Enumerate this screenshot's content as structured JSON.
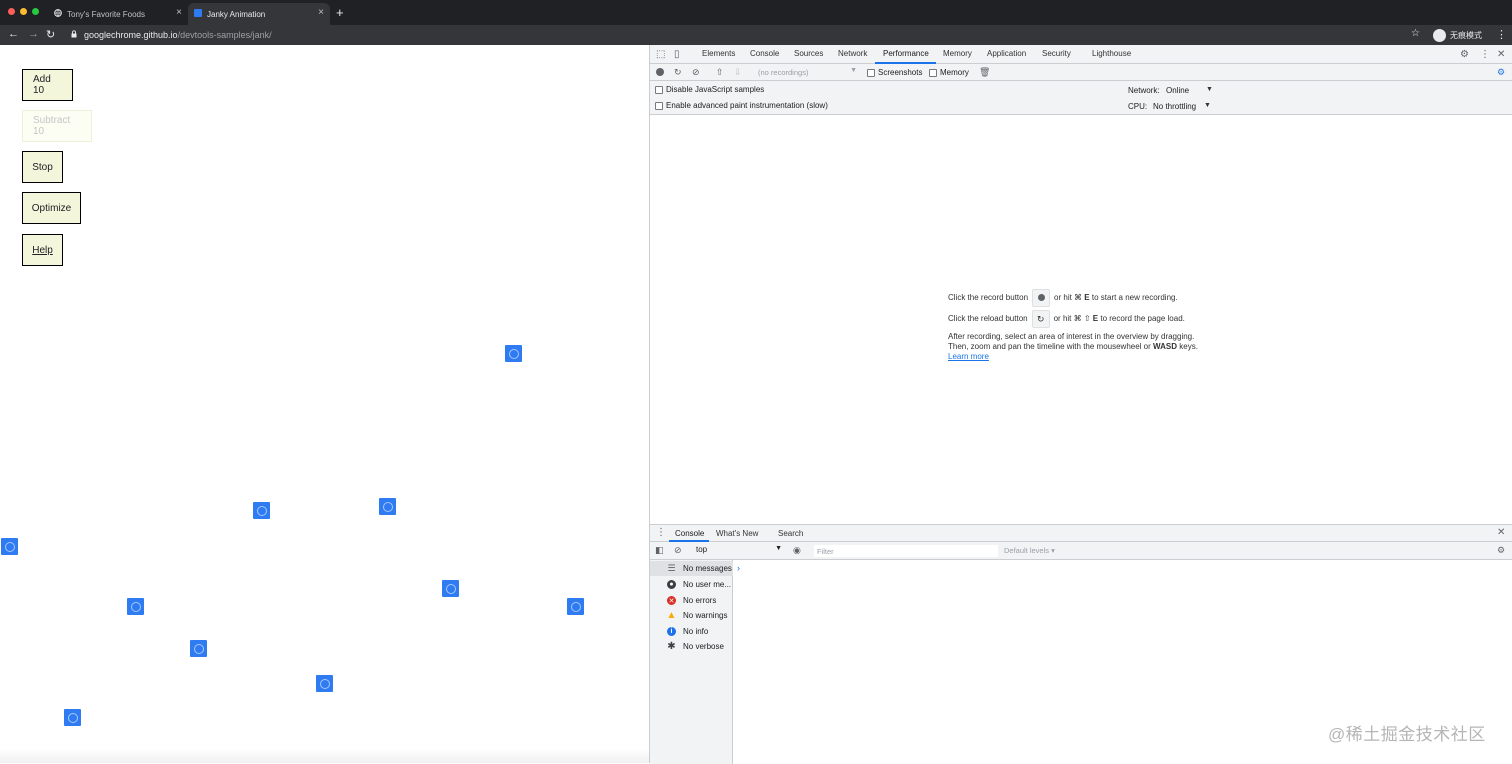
{
  "browser": {
    "tabs": [
      {
        "title": "Tony's Favorite Foods",
        "active": false
      },
      {
        "title": "Janky Animation",
        "active": true
      }
    ],
    "new_tab": "+",
    "tab_close": "×",
    "url_host": "googlechrome.github.io",
    "url_path": "/devtools-samples/jank/",
    "incognito_label": "无痕模式"
  },
  "page": {
    "buttons": {
      "add": "Add 10",
      "subtract": "Subtract 10",
      "stop": "Stop",
      "optimize": "Optimize",
      "help": "Help"
    },
    "mover_color": "#2f7bf2"
  },
  "devtools": {
    "tabs": [
      "Elements",
      "Console",
      "Sources",
      "Network",
      "Performance",
      "Memory",
      "Application",
      "Security",
      "Lighthouse"
    ],
    "active_tab": "Performance",
    "recordings_placeholder": "(no recordings)",
    "screenshots_label": "Screenshots",
    "memory_label": "Memory",
    "disable_js_samples": "Disable JavaScript samples",
    "advanced_paint": "Enable advanced paint instrumentation (slow)",
    "network_label": "Network:",
    "network_value": "Online",
    "cpu_label": "CPU:",
    "cpu_value": "No throttling",
    "landing": {
      "record_pre": "Click the record button",
      "record_post_1": "or hit ⌘",
      "record_key": "E",
      "record_post_2": "to start a new recording.",
      "reload_pre": "Click the reload button",
      "reload_post_1": "or hit ⌘ ⇧",
      "reload_key": "E",
      "reload_post_2": "to record the page load.",
      "after_1": "After recording, select an area of interest in the overview by dragging.",
      "after_2_pre": "Then, zoom and pan the timeline with the mousewheel or",
      "after_2_key": "WASD",
      "after_2_post": "keys.",
      "learn_more": "Learn more"
    },
    "drawer": {
      "tabs": [
        "Console",
        "What's New",
        "Search"
      ],
      "active_tab": "Console",
      "context": "top",
      "filter_placeholder": "Filter",
      "levels": "Default levels ▾",
      "sidebar": [
        {
          "label": "No messages",
          "icon": "list-icon",
          "selected": true
        },
        {
          "label": "No user me...",
          "icon": "user-icon",
          "selected": false
        },
        {
          "label": "No errors",
          "icon": "error-icon",
          "selected": false
        },
        {
          "label": "No warnings",
          "icon": "warning-icon",
          "selected": false
        },
        {
          "label": "No info",
          "icon": "info-icon",
          "selected": false
        },
        {
          "label": "No verbose",
          "icon": "verbose-icon",
          "selected": false
        }
      ],
      "prompt": "›"
    }
  },
  "watermark": "@稀土掘金技术社区",
  "colors": {
    "accent": "#1a73e8",
    "error": "#d93025",
    "warning": "#f9ab00",
    "info": "#1a73e8"
  }
}
